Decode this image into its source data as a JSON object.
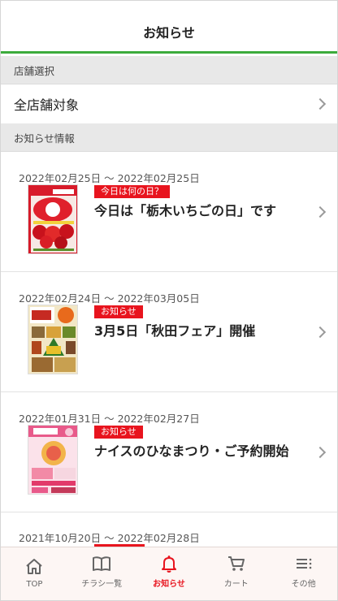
{
  "header": {
    "title": "お知らせ"
  },
  "store_section": {
    "label": "店舗選択",
    "value": "全店舗対象"
  },
  "news_section": {
    "label": "お知らせ情報"
  },
  "news": [
    {
      "date": "2022年02月25日 〜 2022年02月25日",
      "tag": "今日は何の日？",
      "title": "今日は「栃木いちごの日」です"
    },
    {
      "date": "2022年02月24日 〜 2022年03月05日",
      "tag": "お知らせ",
      "title": "3月5日「秋田フェア」開催"
    },
    {
      "date": "2022年01月31日 〜 2022年02月27日",
      "tag": "お知らせ",
      "title": "ナイスのひなまつり・ご予約開始"
    }
  ],
  "partial_item": {
    "date": "2021年10月20日 〜 2022年02月28日"
  },
  "tabbar": {
    "items": [
      {
        "label": "TOP",
        "icon": "home-icon"
      },
      {
        "label": "チラシ一覧",
        "icon": "book-icon"
      },
      {
        "label": "お知らせ",
        "icon": "bell-icon"
      },
      {
        "label": "カート",
        "icon": "cart-icon"
      },
      {
        "label": "その他",
        "icon": "menu-icon"
      }
    ],
    "active_index": 2
  },
  "colors": {
    "accent_red": "#e8141e",
    "header_green": "#3cab3c"
  }
}
